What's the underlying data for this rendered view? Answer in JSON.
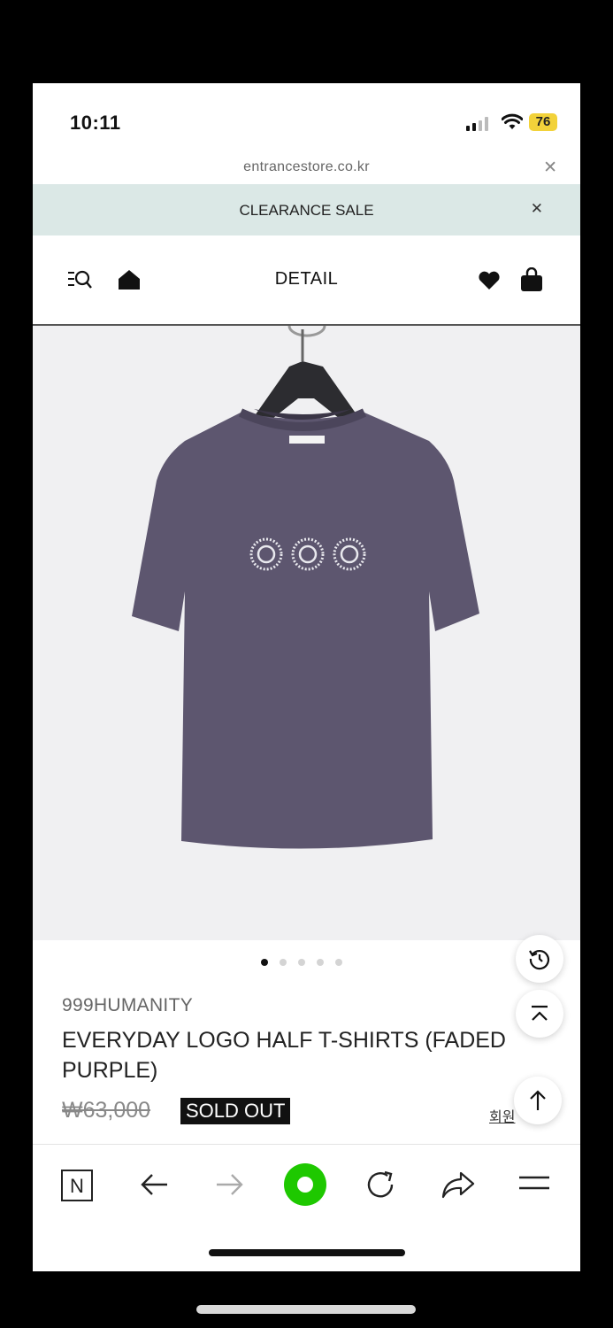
{
  "status_bar": {
    "time": "10:11",
    "battery": "76",
    "battery_color": "#f2d23a"
  },
  "browser": {
    "url": "entrancestore.co.kr",
    "close_icon": "close-icon"
  },
  "banner": {
    "text": "CLEARANCE SALE",
    "close_icon": "close-icon"
  },
  "nav": {
    "title": "DETAIL",
    "icons": [
      "menu-search-icon",
      "home-icon",
      "heart-icon",
      "shopping-bag-icon"
    ]
  },
  "gallery": {
    "image": "purple-tshirt-on-hanger",
    "slide_index": 1,
    "slide_count": 5
  },
  "product": {
    "brand": "999HUMANITY",
    "name": "EVERYDAY LOGO HALF T-SHIRTS (FADED PURPLE)",
    "price": "₩63,000",
    "status_badge": "SOLD OUT",
    "member_link": "회원"
  },
  "floating_buttons": [
    "history-icon",
    "scroll-top-icon",
    "arrow-up-icon"
  ],
  "toolbar": {
    "icons": [
      "naver-n-icon",
      "back-arrow-icon",
      "forward-arrow-icon",
      "green-dot-icon",
      "refresh-icon",
      "share-icon",
      "menu-icon"
    ],
    "accent": "#1ec800"
  }
}
